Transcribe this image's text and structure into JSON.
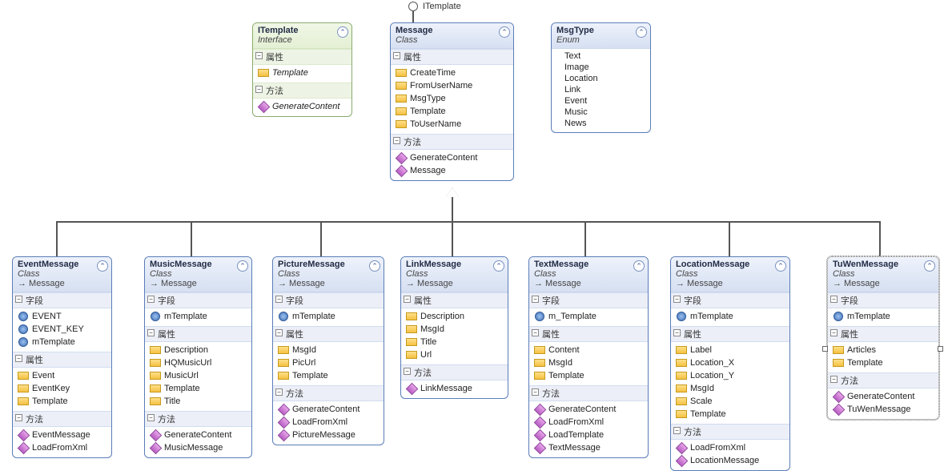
{
  "labels": {
    "interface_near_lollipop": "ITemplate",
    "sec_fields": "字段",
    "sec_props": "属性",
    "sec_methods": "方法"
  },
  "itemplate": {
    "title": "ITemplate",
    "subtitle": "Interface",
    "props": [
      "Template"
    ],
    "methods": [
      "GenerateContent"
    ]
  },
  "message": {
    "title": "Message",
    "subtitle": "Class",
    "props": [
      "CreateTime",
      "FromUserName",
      "MsgType",
      "Template",
      "ToUserName"
    ],
    "methods": [
      "GenerateContent",
      "Message"
    ]
  },
  "msgtype": {
    "title": "MsgType",
    "subtitle": "Enum",
    "values": [
      "Text",
      "Image",
      "Location",
      "Link",
      "Event",
      "Music",
      "News"
    ]
  },
  "children": [
    {
      "key": "event",
      "title": "EventMessage",
      "subtitle": "Class",
      "inherits": "Message",
      "fields": [
        "EVENT",
        "EVENT_KEY",
        "mTemplate"
      ],
      "props": [
        "Event",
        "EventKey",
        "Template"
      ],
      "methods": [
        "EventMessage",
        "LoadFromXml"
      ]
    },
    {
      "key": "music",
      "title": "MusicMessage",
      "subtitle": "Class",
      "inherits": "Message",
      "fields": [
        "mTemplate"
      ],
      "props": [
        "Description",
        "HQMusicUrl",
        "MusicUrl",
        "Template",
        "Title"
      ],
      "methods": [
        "GenerateContent",
        "MusicMessage"
      ]
    },
    {
      "key": "picture",
      "title": "PictureMessage",
      "subtitle": "Class",
      "inherits": "Message",
      "fields": [
        "mTemplate"
      ],
      "props": [
        "MsgId",
        "PicUrl",
        "Template"
      ],
      "methods": [
        "GenerateContent",
        "LoadFromXml",
        "PictureMessage"
      ]
    },
    {
      "key": "link",
      "title": "LinkMessage",
      "subtitle": "Class",
      "inherits": "Message",
      "fields": [],
      "props": [
        "Description",
        "MsgId",
        "Title",
        "Url"
      ],
      "methods": [
        "LinkMessage"
      ]
    },
    {
      "key": "text",
      "title": "TextMessage",
      "subtitle": "Class",
      "inherits": "Message",
      "fields": [
        "m_Template"
      ],
      "props": [
        "Content",
        "MsgId",
        "Template"
      ],
      "methods": [
        "GenerateContent",
        "LoadFromXml",
        "LoadTemplate",
        "TextMessage"
      ]
    },
    {
      "key": "location",
      "title": "LocationMessage",
      "subtitle": "Class",
      "inherits": "Message",
      "fields": [
        "mTemplate"
      ],
      "props": [
        "Label",
        "Location_X",
        "Location_Y",
        "MsgId",
        "Scale",
        "Template"
      ],
      "methods": [
        "LoadFromXml",
        "LocationMessage"
      ]
    },
    {
      "key": "tuwen",
      "title": "TuWenMessage",
      "subtitle": "Class",
      "inherits": "Message",
      "fields": [
        "mTemplate"
      ],
      "props": [
        "Articles",
        "Template"
      ],
      "methods": [
        "GenerateContent",
        "TuWenMessage"
      ]
    }
  ]
}
